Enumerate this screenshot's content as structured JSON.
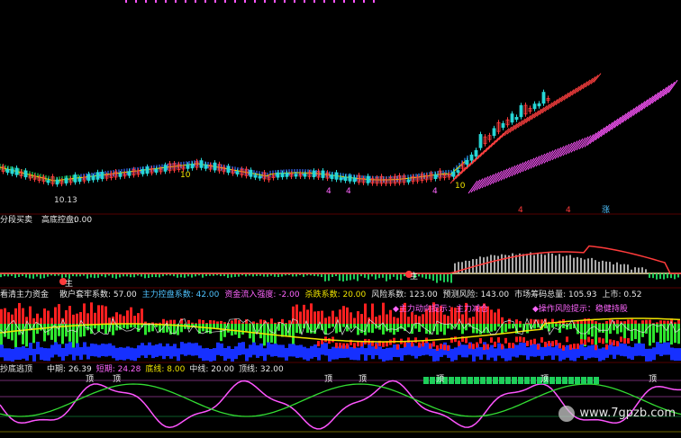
{
  "panel1": {
    "price_label": "10.13",
    "markers": [
      "10",
      "10",
      "4",
      "4",
      "4",
      "10",
      "4",
      "涨",
      "财",
      "4"
    ],
    "colors": {
      "up": "#ff3b3b",
      "down": "#27d6d6",
      "band_low": "#3aa0ff",
      "band_mid": "#f0e400",
      "band_high": "#ff66ff"
    }
  },
  "panel2": {
    "title": "分段买卖",
    "field_label": "高底控盘:",
    "field_value": "0.00",
    "signals": [
      "主",
      "主"
    ]
  },
  "panel3": {
    "title": "看清主力资金",
    "fields": [
      {
        "label": "散户套牢系数:",
        "value": "57.00",
        "color": "#e8e8e8"
      },
      {
        "label": "主力控盘系数:",
        "value": "42.00",
        "color": "#4fc3ff"
      },
      {
        "label": "资金流入强度:",
        "value": "-2.00",
        "color": "#ff66ff"
      },
      {
        "label": "杀跌系数:",
        "value": "20.00",
        "color": "#f0e400"
      },
      {
        "label": "风险系数:",
        "value": "123.00",
        "color": "#e8e8e8"
      },
      {
        "label": "预测风险:",
        "value": "143.00",
        "color": "#e8e8e8"
      },
      {
        "label": "市场筹码总量:",
        "value": "105.93",
        "color": "#e8e8e8"
      },
      {
        "label": "上市:",
        "value": "0.52",
        "color": "#e8e8e8"
      }
    ],
    "notes": [
      {
        "text": "◆主力动向提示：主力减仓",
        "color": "#ff66ff"
      },
      {
        "text": "◆操作风险提示：稳健持股",
        "color": "#ff66ff"
      }
    ]
  },
  "panel4": {
    "title": "抄底逃顶",
    "fields": [
      {
        "label": "中期:",
        "value": "26.39",
        "color": "#e8e8e8"
      },
      {
        "label": "短期:",
        "value": "24.28",
        "color": "#ff66ff"
      },
      {
        "label": "底线:",
        "value": "8.00",
        "color": "#f0e400"
      },
      {
        "label": "中线:",
        "value": "20.00",
        "color": "#e8e8e8"
      },
      {
        "label": "顶线:",
        "value": "32.00",
        "color": "#e8e8e8"
      }
    ],
    "top_marks": [
      "顶",
      "顶",
      "顶",
      "顶",
      "顶",
      "顶",
      "顶"
    ]
  },
  "watermark": "www.7gpzb.com",
  "chart_data": [
    {
      "type": "line",
      "title": "",
      "x": [
        0,
        10,
        20,
        30,
        40,
        50,
        60,
        70,
        80,
        90,
        100
      ],
      "series": [
        {
          "name": "",
          "values": [
            11.2,
            10.8,
            10.1,
            10.6,
            11.0,
            10.9,
            10.5,
            10.3,
            10.6,
            11.8,
            13.0
          ]
        }
      ]
    },
    {
      "type": "line",
      "title": "分段买卖",
      "series": [
        {
          "name": "",
          "values": [
            0,
            0,
            0,
            0,
            0,
            0,
            0,
            0,
            0.6,
            0.9,
            0.4
          ]
        }
      ]
    },
    {
      "type": "bar",
      "title": "看清主力资金",
      "series": [
        {
          "name": "散户套牢系数",
          "values": [
            57
          ]
        },
        {
          "name": "主力控盘系数",
          "values": [
            42
          ]
        },
        {
          "name": "资金流入强度",
          "values": [
            -2
          ]
        },
        {
          "name": "杀跌系数",
          "values": [
            20
          ]
        }
      ]
    },
    {
      "type": "line",
      "title": "抄底逃顶",
      "series": [
        {
          "name": "中期",
          "values": [
            26.39
          ]
        },
        {
          "name": "短期",
          "values": [
            24.28
          ]
        }
      ],
      "reference_lines": [
        {
          "name": "底线",
          "value": 8
        },
        {
          "name": "中线",
          "value": 20
        },
        {
          "name": "顶线",
          "value": 32
        }
      ]
    }
  ]
}
